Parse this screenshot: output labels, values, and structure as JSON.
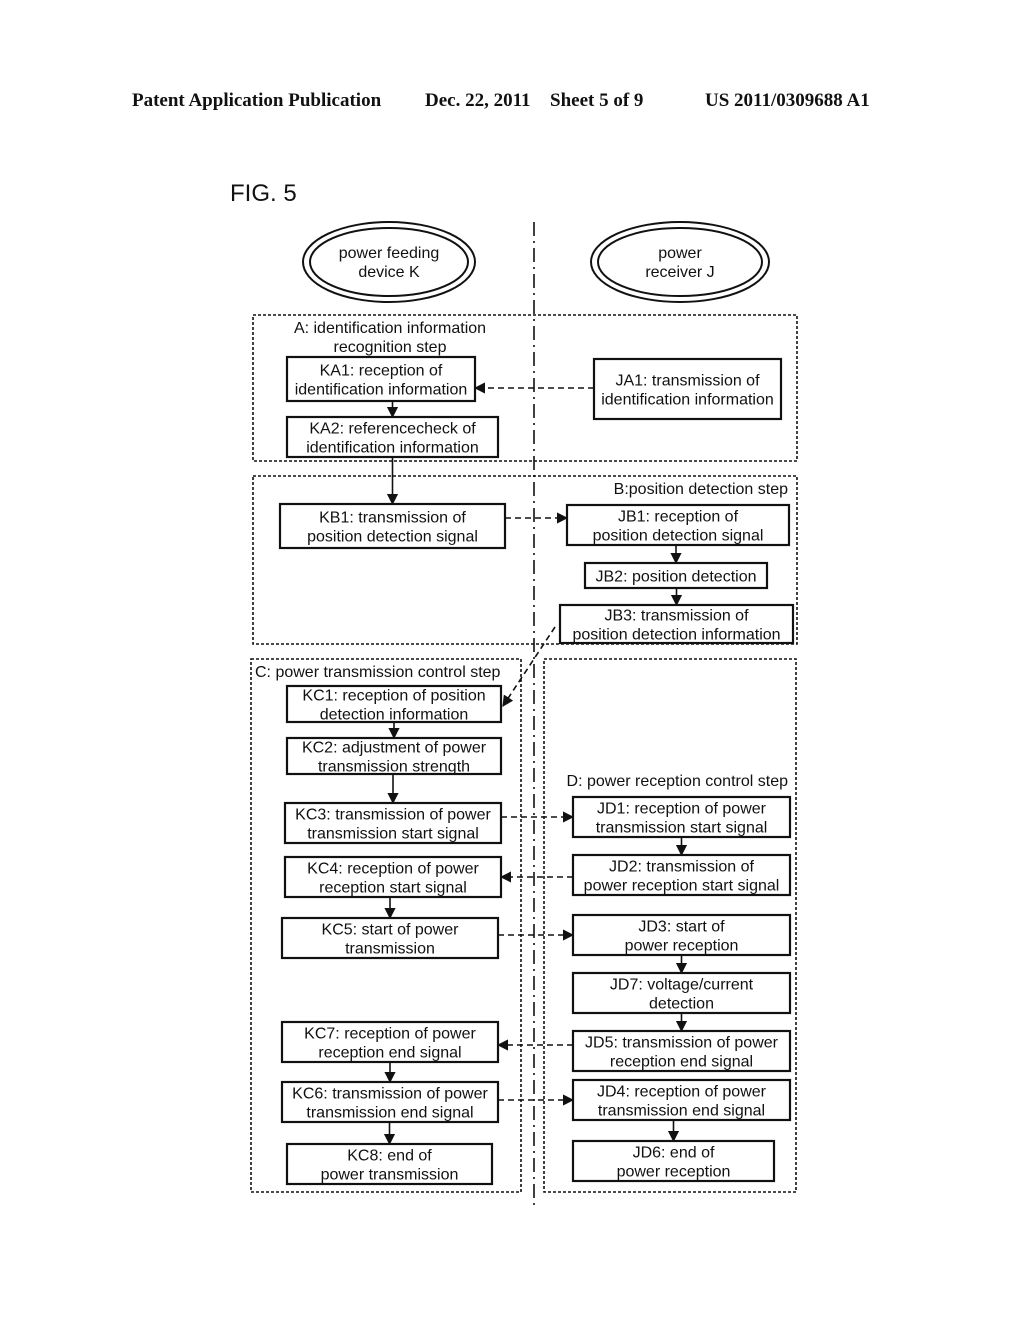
{
  "header": {
    "publication": "Patent Application Publication",
    "date": "Dec. 22, 2011",
    "sheet": "Sheet 5 of 9",
    "number": "US 2011/0309688 A1"
  },
  "figure": {
    "label": "FIG. 5"
  },
  "actors": [
    {
      "id": "K",
      "lines": [
        "power feeding",
        "device K"
      ]
    },
    {
      "id": "J",
      "lines": [
        "power",
        "receiver J"
      ]
    }
  ],
  "steps": [
    {
      "id": "A",
      "lines": [
        "A: identification information",
        "recognition step"
      ]
    },
    {
      "id": "B",
      "lines": [
        "B:position detection step"
      ]
    },
    {
      "id": "C",
      "lines": [
        "C: power transmission control step"
      ]
    },
    {
      "id": "D",
      "lines": [
        "D: power reception control step"
      ]
    }
  ],
  "nodes": [
    {
      "id": "KA1",
      "lines": [
        "KA1: reception of",
        "identification information"
      ]
    },
    {
      "id": "KA2",
      "lines": [
        "KA2: referencecheck of",
        "identification information"
      ]
    },
    {
      "id": "JA1",
      "lines": [
        "JA1: transmission of",
        "identification information"
      ]
    },
    {
      "id": "KB1",
      "lines": [
        "KB1: transmission of",
        "position detection signal"
      ]
    },
    {
      "id": "JB1",
      "lines": [
        "JB1: reception of",
        "position detection signal"
      ]
    },
    {
      "id": "JB2",
      "lines": [
        "JB2: position detection"
      ]
    },
    {
      "id": "JB3",
      "lines": [
        "JB3: transmission of",
        "position detection information"
      ]
    },
    {
      "id": "KC1",
      "lines": [
        "KC1: reception of position",
        "detection information"
      ]
    },
    {
      "id": "KC2",
      "lines": [
        "KC2: adjustment of power",
        "transmission strength"
      ]
    },
    {
      "id": "KC3",
      "lines": [
        "KC3: transmission of power",
        "transmission start signal"
      ]
    },
    {
      "id": "KC4",
      "lines": [
        "KC4: reception of power",
        "reception start signal"
      ]
    },
    {
      "id": "KC5",
      "lines": [
        "KC5: start of power",
        "transmission"
      ]
    },
    {
      "id": "KC7",
      "lines": [
        "KC7: reception of power",
        "reception end signal"
      ]
    },
    {
      "id": "KC6",
      "lines": [
        "KC6: transmission of power",
        "transmission end signal"
      ]
    },
    {
      "id": "KC8",
      "lines": [
        "KC8: end of",
        "power transmission"
      ]
    },
    {
      "id": "JD1",
      "lines": [
        "JD1: reception of power",
        "transmission start signal"
      ]
    },
    {
      "id": "JD2",
      "lines": [
        "JD2: transmission of",
        "power reception start signal"
      ]
    },
    {
      "id": "JD3",
      "lines": [
        "JD3: start of",
        "power reception"
      ]
    },
    {
      "id": "JD7",
      "lines": [
        "JD7: voltage/current",
        "detection"
      ]
    },
    {
      "id": "JD5",
      "lines": [
        "JD5: transmission of power",
        "reception end signal"
      ]
    },
    {
      "id": "JD4",
      "lines": [
        "JD4: reception of power",
        "transmission end signal"
      ]
    },
    {
      "id": "JD6",
      "lines": [
        "JD6: end of",
        "power reception"
      ]
    }
  ],
  "flows": [
    {
      "from": "KA1",
      "to": "KA2",
      "style": "solid"
    },
    {
      "from": "KA2",
      "to": "KB1",
      "style": "solid"
    },
    {
      "from": "JB1",
      "to": "JB2",
      "style": "solid"
    },
    {
      "from": "JB2",
      "to": "JB3",
      "style": "solid"
    },
    {
      "from": "KC1",
      "to": "KC2",
      "style": "solid"
    },
    {
      "from": "KC2",
      "to": "KC3",
      "style": "solid"
    },
    {
      "from": "KC4",
      "to": "KC5",
      "style": "solid"
    },
    {
      "from": "KC7",
      "to": "KC6",
      "style": "solid"
    },
    {
      "from": "KC6",
      "to": "KC8",
      "style": "solid"
    },
    {
      "from": "JD1",
      "to": "JD2",
      "style": "solid"
    },
    {
      "from": "JD3",
      "to": "JD7",
      "style": "solid"
    },
    {
      "from": "JD7",
      "to": "JD5",
      "style": "solid"
    },
    {
      "from": "JD4",
      "to": "JD6",
      "style": "solid"
    },
    {
      "from": "JA1",
      "to": "KA1",
      "style": "dashed"
    },
    {
      "from": "KB1",
      "to": "JB1",
      "style": "dashed"
    },
    {
      "from": "JB3",
      "to": "KC1",
      "style": "dashed"
    },
    {
      "from": "KC3",
      "to": "JD1",
      "style": "dashed"
    },
    {
      "from": "JD2",
      "to": "KC4",
      "style": "dashed"
    },
    {
      "from": "KC5",
      "to": "JD3",
      "style": "dashed"
    },
    {
      "from": "JD5",
      "to": "KC7",
      "style": "dashed"
    },
    {
      "from": "KC6",
      "to": "JD4",
      "style": "dashed"
    }
  ]
}
